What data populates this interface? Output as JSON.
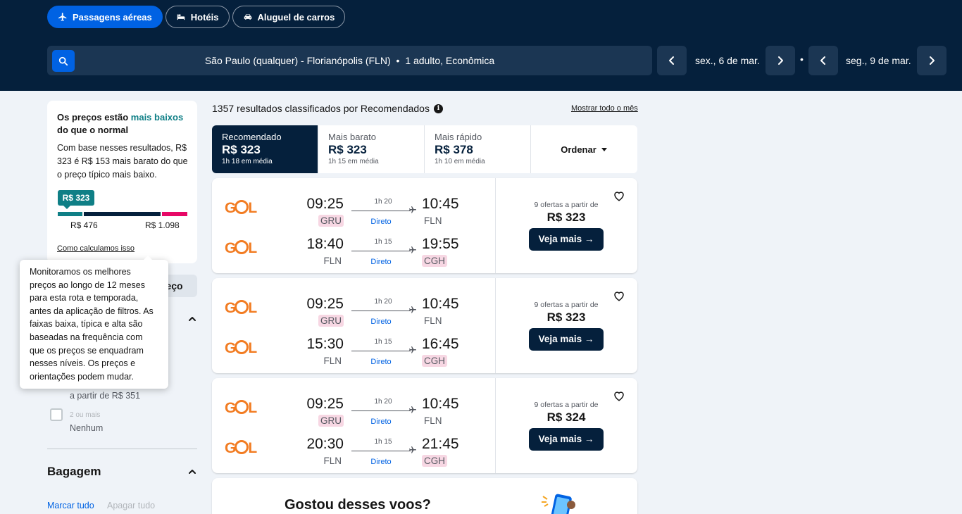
{
  "tabs": [
    {
      "label": "Passagens aéreas",
      "icon": "plane-icon",
      "active": true
    },
    {
      "label": "Hotéis",
      "icon": "bed-icon",
      "active": false
    },
    {
      "label": "Aluguel de carros",
      "icon": "car-icon",
      "active": false
    }
  ],
  "search": {
    "route": "São Paulo (qualquer) - Florianópolis (FLN)",
    "separator": "•",
    "passengers": "1 adulto, Econômica",
    "depart_date": "sex., 6 de mar.",
    "return_date": "seg., 9 de mar.",
    "date_separator": "•"
  },
  "price_card": {
    "title_prefix": "Os preços estão ",
    "title_highlight": "mais baixos",
    "title_suffix": " do que o normal",
    "body": "Com base nesses resultados, R$ 323 é R$ 153 mais barato do que o preço típico mais baixo.",
    "badge": "R$ 323",
    "low_label": "R$ 476",
    "high_label": "R$ 1.098",
    "link": "Como calculamos isso",
    "colors": {
      "low": "#0f7f86",
      "typical": "#05203c",
      "high": "#e70866"
    }
  },
  "tooltip": "Monitoramos os melhores preços ao longo de 12 meses para esta rota e temporada, antes da aplicação de filtros. As faixas baixa, típica e alta são baseadas na frequência com que os preços se enquadram nesses níveis. Os preços e orientações podem mudar.",
  "sidebar": {
    "hidden_pill": "reço",
    "stop_price": "a partir de R$ 351",
    "stop_option": "2 ou mais",
    "stop_option_value": "Nenhum",
    "bag_title": "Bagagem",
    "select_all": "Marcar tudo",
    "clear_all": "Apagar tudo"
  },
  "results": {
    "count_text": "1357 resultados classificados por Recomendados",
    "show_month": "Mostrar todo o mês"
  },
  "sort_tabs": [
    {
      "label": "Recomendado",
      "price": "R$ 323",
      "duration": "1h 18 em média",
      "active": true
    },
    {
      "label": "Mais barato",
      "price": "R$ 323",
      "duration": "1h 15 em média",
      "active": false
    },
    {
      "label": "Mais rápido",
      "price": "R$ 378",
      "duration": "1h 10 em média",
      "active": false
    }
  ],
  "order_label": "Ordenar",
  "flights": [
    {
      "offers": "9 ofertas a partir de",
      "price": "R$ 323",
      "cta": "Veja mais →",
      "legs": [
        {
          "airline": "GOL",
          "dep": "09:25",
          "dep_ap": "GRU",
          "dep_hl": true,
          "dur": "1h 20",
          "stops": "Direto",
          "arr": "10:45",
          "arr_ap": "FLN",
          "arr_hl": false
        },
        {
          "airline": "GOL",
          "dep": "18:40",
          "dep_ap": "FLN",
          "dep_hl": false,
          "dur": "1h 15",
          "stops": "Direto",
          "arr": "19:55",
          "arr_ap": "CGH",
          "arr_hl": true
        }
      ]
    },
    {
      "offers": "9 ofertas a partir de",
      "price": "R$ 323",
      "cta": "Veja mais →",
      "legs": [
        {
          "airline": "GOL",
          "dep": "09:25",
          "dep_ap": "GRU",
          "dep_hl": true,
          "dur": "1h 20",
          "stops": "Direto",
          "arr": "10:45",
          "arr_ap": "FLN",
          "arr_hl": false
        },
        {
          "airline": "GOL",
          "dep": "15:30",
          "dep_ap": "FLN",
          "dep_hl": false,
          "dur": "1h 15",
          "stops": "Direto",
          "arr": "16:45",
          "arr_ap": "CGH",
          "arr_hl": true
        }
      ]
    },
    {
      "offers": "9 ofertas a partir de",
      "price": "R$ 324",
      "cta": "Veja mais →",
      "legs": [
        {
          "airline": "GOL",
          "dep": "09:25",
          "dep_ap": "GRU",
          "dep_hl": true,
          "dur": "1h 20",
          "stops": "Direto",
          "arr": "10:45",
          "arr_ap": "FLN",
          "arr_hl": false
        },
        {
          "airline": "GOL",
          "dep": "20:30",
          "dep_ap": "FLN",
          "dep_hl": false,
          "dur": "1h 15",
          "stops": "Direto",
          "arr": "21:45",
          "arr_ap": "CGH",
          "arr_hl": true
        }
      ]
    }
  ],
  "promo": {
    "title": "Gostou desses voos?"
  }
}
